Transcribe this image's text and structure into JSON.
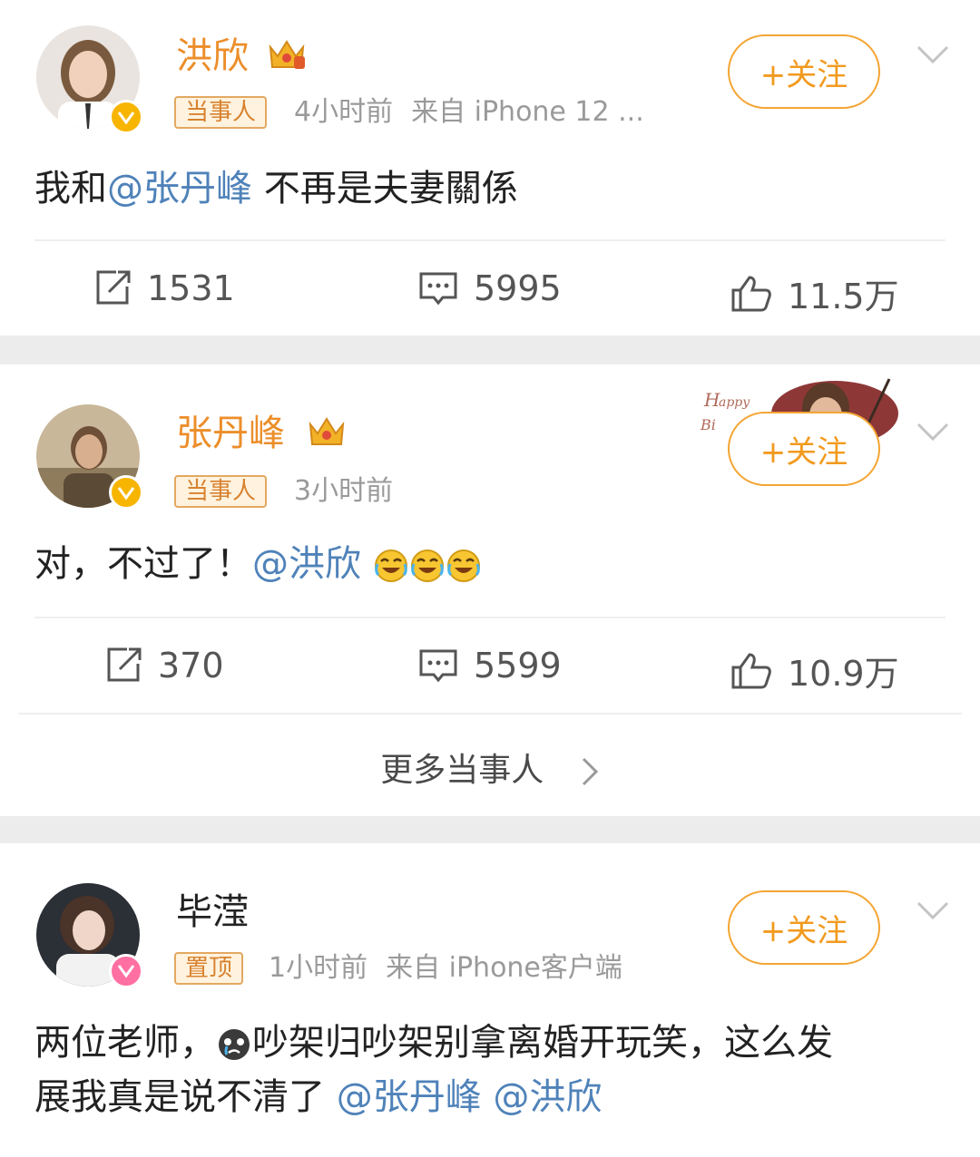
{
  "posts": [
    {
      "name": "洪欣",
      "tag": "当事人",
      "time": "4小时前",
      "source": "来自 iPhone 12 ...",
      "follow_label": "+关注",
      "text_before": "我和",
      "mention": "@张丹峰",
      "text_after": " 不再是夫妻關係",
      "reposts": "1531",
      "comments": "5995",
      "likes": "11.5万"
    },
    {
      "name": "张丹峰",
      "tag": "当事人",
      "time": "3小时前",
      "follow_label": "+关注",
      "text_before": "对，不过了！",
      "mention": "@洪欣",
      "reposts": "370",
      "comments": "5599",
      "likes": "10.9万",
      "more_label": "更多当事人"
    },
    {
      "name": "毕滢",
      "tag": "置顶",
      "time": "1小时前",
      "source": "来自 iPhone客户端",
      "follow_label": "+关注",
      "line1_before": "两位老师，",
      "line1_after": "吵架归吵架别拿离婚开玩笑，这么发",
      "line2_before": "展我真是说不清了 ",
      "mention1": "@张丹峰",
      "mention2": " @洪欣"
    }
  ],
  "colors": {
    "accent_orange": "#f29a1e",
    "mention_blue": "#4f82b9",
    "gap_gray": "#ececec"
  },
  "icons": [
    "repost-icon",
    "comment-icon",
    "like-icon",
    "chevron-down-icon",
    "chevron-right-icon",
    "crown-icon",
    "verified-badge-icon",
    "laugh-cry-emoji",
    "crying-emoji"
  ]
}
